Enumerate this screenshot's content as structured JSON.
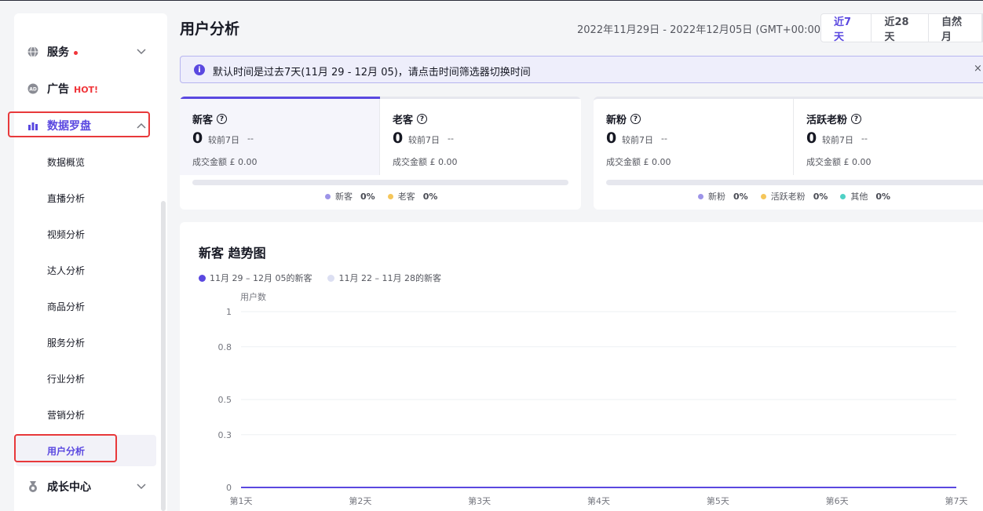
{
  "sidebar": {
    "items": [
      {
        "label": "服务",
        "icon": "globe-icon"
      },
      {
        "label": "广告",
        "badge": "HOT!",
        "icon": "ad-icon"
      },
      {
        "label": "数据罗盘",
        "icon": "bar-chart-icon"
      },
      {
        "label": "成长中心",
        "icon": "medal-icon"
      }
    ],
    "sub_items": [
      "数据概览",
      "直播分析",
      "视频分析",
      "达人分析",
      "商品分析",
      "服务分析",
      "行业分析",
      "营销分析",
      "用户分析"
    ]
  },
  "header": {
    "title": "用户分析",
    "date_range": "2022年11月29日 - 2022年12月05日 (GMT+00:00)",
    "range_tabs": [
      "近7天",
      "近28天",
      "自然月"
    ]
  },
  "notice": {
    "text": "默认时间是过去7天(11月 29 - 12月 05)，请点击时间筛选器切换时间",
    "close": "×"
  },
  "customer_card": {
    "metrics": [
      {
        "title": "新客",
        "value": "0",
        "compare_label": "较前7日",
        "compare_value": "--",
        "amount": "成交金额 £ 0.00"
      },
      {
        "title": "老客",
        "value": "0",
        "compare_label": "较前7日",
        "compare_value": "--",
        "amount": "成交金额 £ 0.00"
      }
    ],
    "legend": [
      {
        "label": "新客",
        "pct": "0%",
        "color": "#9d94e8"
      },
      {
        "label": "老客",
        "pct": "0%",
        "color": "#f5c65a"
      }
    ]
  },
  "fan_card": {
    "metrics": [
      {
        "title": "新粉",
        "value": "0",
        "compare_label": "较前7日",
        "compare_value": "--",
        "amount": "成交金额 £ 0.00"
      },
      {
        "title": "活跃老粉",
        "value": "0",
        "compare_label": "较前7日",
        "compare_value": "--",
        "amount": "成交金额 £ 0.00"
      }
    ],
    "legend": [
      {
        "label": "新粉",
        "pct": "0%",
        "color": "#9d94e8"
      },
      {
        "label": "活跃老粉",
        "pct": "0%",
        "color": "#f5c65a"
      },
      {
        "label": "其他",
        "pct": "0%",
        "color": "#4fd1c5"
      }
    ]
  },
  "chart_data": {
    "type": "line",
    "title": "新客 趋势图",
    "ylabel": "用户数",
    "categories": [
      "第1天",
      "第2天",
      "第3天",
      "第4天",
      "第5天",
      "第6天",
      "第7天"
    ],
    "yticks": [
      "1",
      "0.8",
      "0.5",
      "0.3",
      "0"
    ],
    "ylim": [
      0,
      1
    ],
    "grid": true,
    "series": [
      {
        "name": "11月 29 – 12月 05的新客",
        "color": "#5a48e0",
        "values": [
          0,
          0,
          0,
          0,
          0,
          0,
          0
        ]
      },
      {
        "name": "11月 22 – 11月 28的新客",
        "color": "#dcdff2",
        "values": [
          0,
          0,
          0,
          0,
          0,
          0,
          0
        ]
      }
    ]
  },
  "colors": {
    "accent": "#5a48e0",
    "highlight_box": "#e8393b",
    "hot": "#f0353a"
  }
}
